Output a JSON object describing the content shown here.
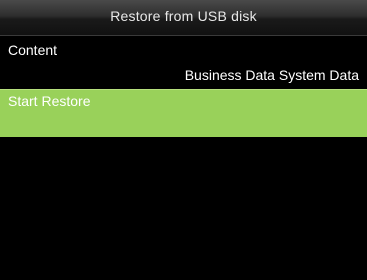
{
  "header": {
    "title": "Restore from USB disk"
  },
  "menu": {
    "content": {
      "label": "Content",
      "value": "Business Data System Data"
    },
    "start_restore": {
      "label": "Start Restore"
    }
  },
  "colors": {
    "background": "#000000",
    "highlight": "#99d15a",
    "text": "#ffffff"
  }
}
